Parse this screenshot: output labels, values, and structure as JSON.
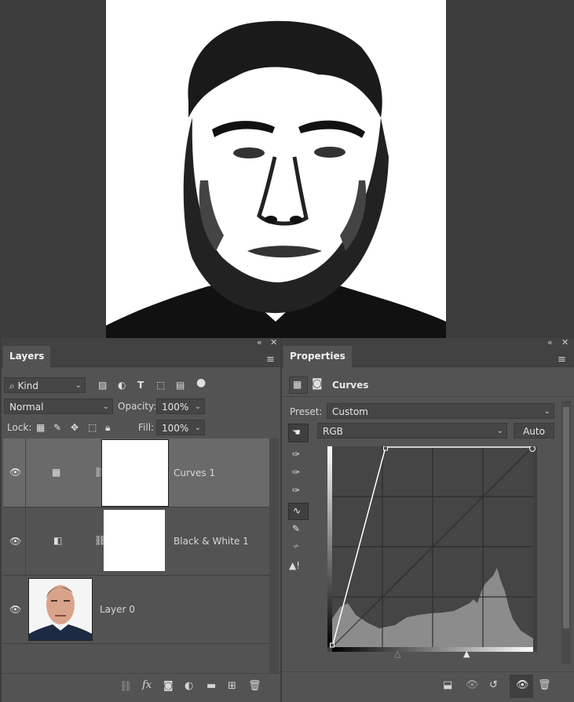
{
  "layers_panel": {
    "tab": "Layers",
    "filter": {
      "kind_label": "Kind"
    },
    "blend_mode": "Normal",
    "opacity_label": "Opacity:",
    "opacity_value": "100%",
    "lock_label": "Lock:",
    "fill_label": "Fill:",
    "fill_value": "100%",
    "layers": [
      {
        "name": "Curves 1",
        "selected": true
      },
      {
        "name": "Black & White 1",
        "selected": false
      },
      {
        "name": "Layer 0",
        "selected": false
      }
    ],
    "icons": {
      "collapse": "double-chevron-left-icon",
      "close": "close-icon",
      "menu": "hamburger-icon"
    }
  },
  "properties_panel": {
    "tab": "Properties",
    "adjustment_name": "Curves",
    "preset_label": "Preset:",
    "preset_value": "Custom",
    "channel_value": "RGB",
    "auto_label": "Auto",
    "curve_points": [
      [
        0,
        0
      ],
      [
        68,
        255
      ],
      [
        255,
        255
      ]
    ],
    "colors": {
      "panel": "#535353",
      "graph_bg": "#454545",
      "histogram": "#8c8c8c",
      "curve": "#ffffff"
    }
  }
}
